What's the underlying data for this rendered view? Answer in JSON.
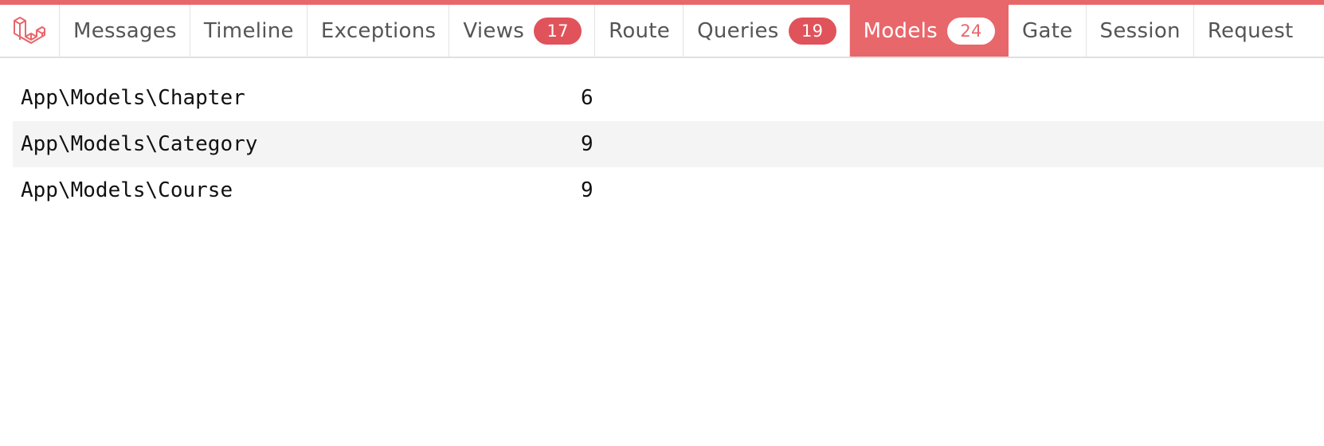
{
  "toolbar": {
    "logo_icon": "laravel-logo-icon",
    "accent_color": "#e8676b",
    "tabs": [
      {
        "label": "Messages",
        "badge": null,
        "active": false
      },
      {
        "label": "Timeline",
        "badge": null,
        "active": false
      },
      {
        "label": "Exceptions",
        "badge": null,
        "active": false
      },
      {
        "label": "Views",
        "badge": "17",
        "active": false
      },
      {
        "label": "Route",
        "badge": null,
        "active": false
      },
      {
        "label": "Queries",
        "badge": "19",
        "active": false
      },
      {
        "label": "Models",
        "badge": "24",
        "active": true
      },
      {
        "label": "Gate",
        "badge": null,
        "active": false
      },
      {
        "label": "Session",
        "badge": null,
        "active": false
      },
      {
        "label": "Request",
        "badge": null,
        "active": false
      }
    ]
  },
  "models": {
    "rows": [
      {
        "name": "App\\Models\\Chapter",
        "count": "6"
      },
      {
        "name": "App\\Models\\Category",
        "count": "9"
      },
      {
        "name": "App\\Models\\Course",
        "count": "9"
      }
    ]
  }
}
